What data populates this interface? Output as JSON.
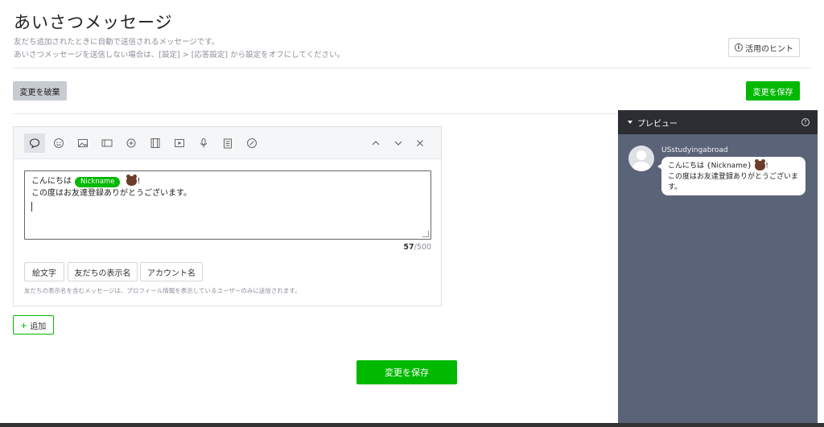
{
  "page": {
    "title": "あいさつメッセージ",
    "desc_line1": "友だち追加されたときに自動で送信されるメッセージです。",
    "desc_line2": "あいさつメッセージを送信しない場合は、[設定] > [応答設定] から設定をオフにしてください。",
    "hint_label": "活用のヒント"
  },
  "actions": {
    "discard_label": "変更を破棄",
    "save_label": "変更を保存",
    "add_label": "追加"
  },
  "editor": {
    "line1_prefix": "こんにちは",
    "nickname_badge": "Nickname",
    "line1_suffix": "!",
    "line2": "この度はお友達登録ありがとうございます。",
    "char_count": "57",
    "char_max": "/500",
    "insert_buttons": [
      "絵文字",
      "友だちの表示名",
      "アカウント名"
    ],
    "note": "友だちの表示名を含むメッセージは、プロフィール情報を表示しているユーザーのみに送信されます。",
    "toolbar_icons": [
      "text-bubble-icon",
      "emoji-icon",
      "image-icon",
      "card-icon",
      "richmessage-icon",
      "video-icon",
      "play-icon",
      "voice-icon",
      "survey-icon",
      "coupon-icon",
      "chevron-up-icon",
      "chevron-down-icon",
      "close-icon"
    ]
  },
  "preview": {
    "header": "プレビュー",
    "account_name": "USstudyingabroad",
    "line1": "こんにちは {Nickname}",
    "line1_suffix": "!",
    "line2": "この度はお友達登録ありがとうございます。"
  },
  "colors": {
    "accent": "#00b900",
    "preview_bg": "#5b6379",
    "preview_header": "#2b2d32"
  }
}
